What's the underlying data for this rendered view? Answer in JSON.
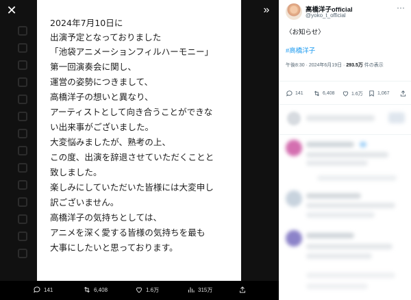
{
  "modal": {
    "close_icon": "✕",
    "collapse_icon": "»"
  },
  "document_lines": [
    "2024年7月10日に",
    "出演予定となっておりました",
    "「池袋アニメーションフィルハーモニー」",
    "第一回演奏会に関し、",
    "運営の姿勢につきまして、",
    "高橋洋子の想いと異なり、",
    "アーティストとして向き合うことができな",
    "い出来事がございました。",
    "大変悩みましたが、熟考の上、",
    "この度、出演を辞退させていただくことと",
    "致しました。",
    "楽しみにしていただいた皆様には大変申し",
    "訳ございません。",
    "高橋洋子の気持ちとしては、",
    "アニメを深く愛する皆様の気持ちを最も",
    "大事にしたいと思っております。"
  ],
  "bottom_bar": {
    "replies": "141",
    "reposts": "6,408",
    "likes": "1.6万",
    "views": "315万"
  },
  "tweet": {
    "author_name": "高橋洋子official",
    "author_handle": "@yoko_t_official",
    "text": "〈お知らせ〉",
    "hashtag": "#高橋洋子",
    "meta_time": "午後8:30 · 2024年6月19日 · ",
    "meta_views": "293.5万",
    "meta_views_suffix": " 件の表示",
    "replies": "141",
    "reposts": "6,408",
    "likes": "1.6万",
    "bookmarks": "1,067"
  },
  "colors": {
    "accent": "#1d9bf0",
    "text": "#0f1419",
    "muted": "#536471"
  }
}
